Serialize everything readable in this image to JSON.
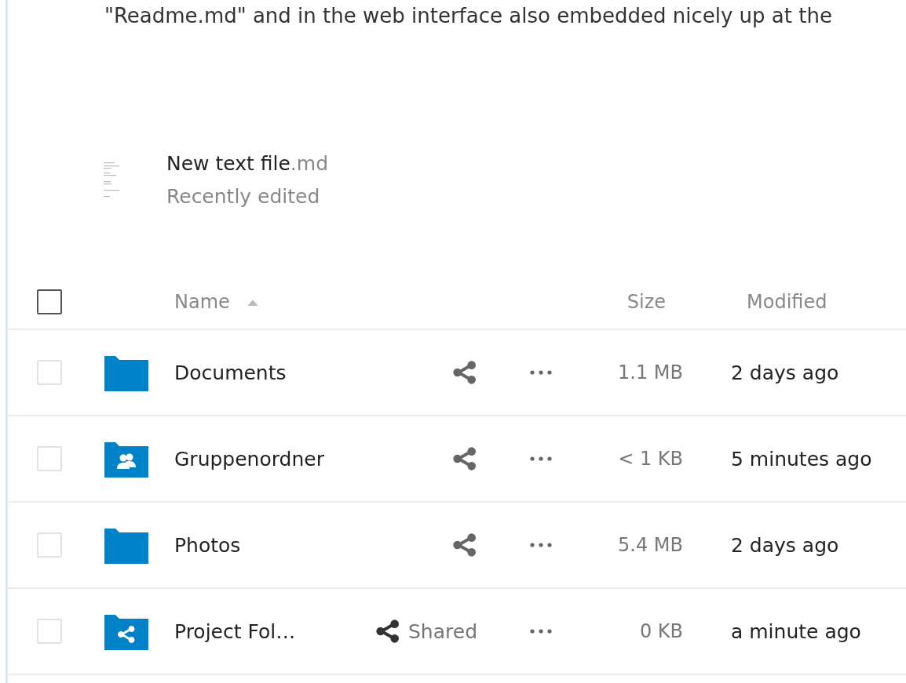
{
  "intro_text": "\"Readme.md\" and in the web interface also embedded nicely up at the",
  "recent_file": {
    "name": "New text file",
    "extension": ".md",
    "status": "Recently edited"
  },
  "table": {
    "select_all": {
      "checked": false
    },
    "columns": [
      {
        "label": "Name",
        "sorted": true
      },
      {
        "label": "Size",
        "sorted": false
      },
      {
        "label": "Modified",
        "sorted": false
      }
    ],
    "rows": [
      {
        "kind": "folder",
        "name": "Documents",
        "shared": false,
        "size": "1.1 MB",
        "modified": "2 days ago",
        "checked": false
      },
      {
        "kind": "group",
        "name": "Gruppenordner",
        "shared": false,
        "size": "< 1 KB",
        "modified": "5 minutes ago",
        "checked": false
      },
      {
        "kind": "folder",
        "name": "Photos",
        "shared": false,
        "size": "5.4 MB",
        "modified": "2 days ago",
        "checked": false
      },
      {
        "kind": "shared",
        "name": "Project Fol…",
        "shared": true,
        "share_label": "Shared",
        "size": "0 KB",
        "modified": "a minute ago",
        "checked": false
      }
    ]
  }
}
